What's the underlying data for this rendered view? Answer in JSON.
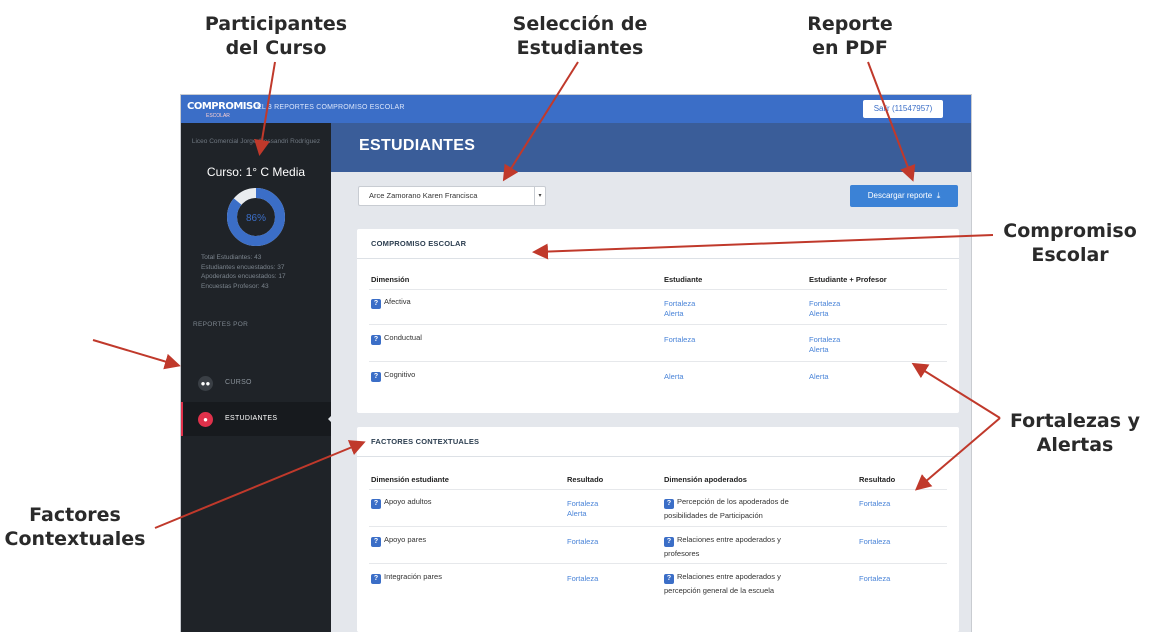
{
  "annotations": {
    "participantes": [
      "Participantes",
      "del Curso"
    ],
    "seleccion": [
      "Selección de",
      "Estudiantes"
    ],
    "reporte": [
      "Reporte",
      "en PDF"
    ],
    "compromiso": [
      "Compromiso",
      "Escolar"
    ],
    "fortalezas": [
      "Fortalezas y",
      "Alertas"
    ],
    "factores": [
      "Factores",
      "Contextuales"
    ]
  },
  "topbar": {
    "logo": "COMPROMISO",
    "logo_sub": "ESCOLAR",
    "breadcrumb": "EL 3 REPORTES COMPROMISO ESCOLAR",
    "user_button": "Salir (11547957)"
  },
  "sidebar": {
    "school": "Liceo Comercial Jorge Alessandri Rodríguez",
    "course": "Curso: 1° C Media",
    "progress": {
      "value": 86,
      "label": "86%"
    },
    "stats": [
      "Total Estudiantes: 43",
      "Estudiantes encuestados: 37",
      "Apoderados encuestados: 17",
      "Encuestas Profesor: 43"
    ],
    "section": "REPORTES POR",
    "nav": [
      {
        "label": "CURSO",
        "icon": "users-icon",
        "active": false
      },
      {
        "label": "ESTUDIANTES",
        "icon": "user-icon",
        "active": true
      }
    ]
  },
  "main": {
    "title": "ESTUDIANTES",
    "student_select": "Arce Zamorano Karen Francisca",
    "download_button": "Descargar reporte"
  },
  "compromiso": {
    "title": "COMPROMISO ESCOLAR",
    "headers": [
      "Dimensión",
      "Estudiante",
      "Estudiante + Profesor"
    ],
    "rows": [
      {
        "dim": "Afectiva",
        "est": [
          "Fortaleza",
          "Alerta"
        ],
        "prof": [
          "Fortaleza",
          "Alerta"
        ]
      },
      {
        "dim": "Conductual",
        "est": [
          "Fortaleza"
        ],
        "prof": [
          "Fortaleza",
          "Alerta"
        ]
      },
      {
        "dim": "Cognitivo",
        "est": [
          "Alerta"
        ],
        "prof": [
          "Alerta"
        ]
      }
    ]
  },
  "factores": {
    "title": "FACTORES CONTEXTUALES",
    "headers": [
      "Dimensión estudiante",
      "Resultado",
      "Dimensión apoderados",
      "Resultado"
    ],
    "rows": [
      {
        "dim": "Apoyo adultos",
        "res": [
          "Fortaleza",
          "Alerta"
        ],
        "apo": [
          "Percepción de los apoderados de",
          "posibilidades de Participación"
        ],
        "res2": "Fortaleza"
      },
      {
        "dim": "Apoyo pares",
        "res": [
          "Fortaleza"
        ],
        "apo": [
          "Relaciones entre apoderados y",
          "profesores"
        ],
        "res2": "Fortaleza"
      },
      {
        "dim": "Integración pares",
        "res": [
          "Fortaleza"
        ],
        "apo": [
          "Relaciones entre apoderados y",
          "percepción general de la escuela"
        ],
        "res2": "Fortaleza"
      }
    ]
  },
  "colors": {
    "accent": "#3b6ec7",
    "header": "#3a5d99",
    "sidebar": "#1f2328",
    "arrow": "#c0392b",
    "active": "#e0314b"
  }
}
